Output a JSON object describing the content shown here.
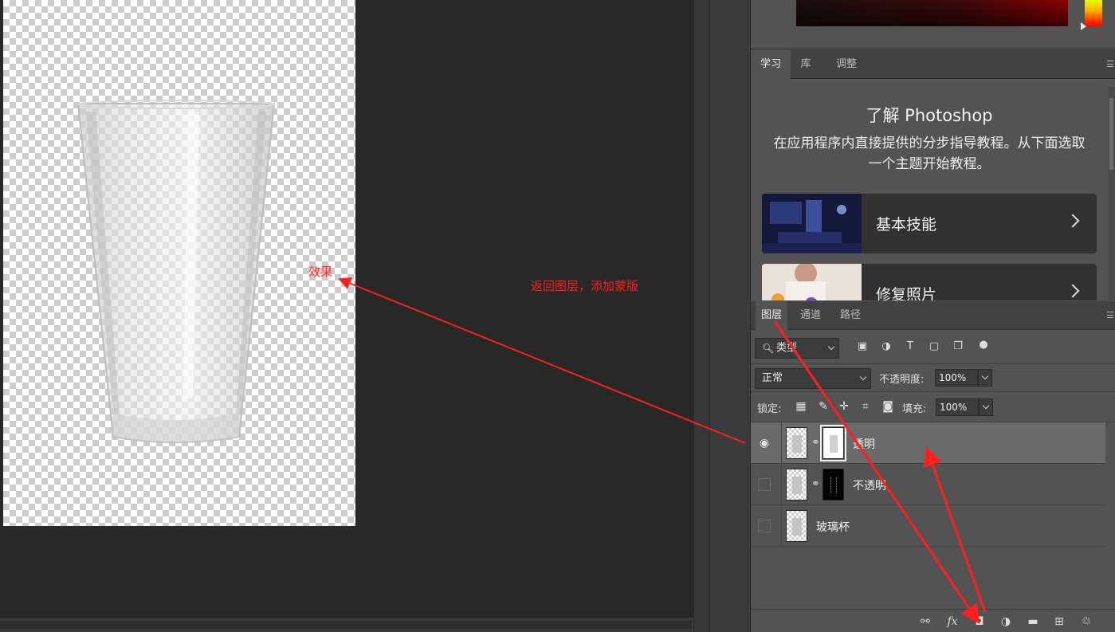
{
  "annotations": {
    "effect": "效果",
    "instruction": "返回图层，添加蒙版"
  },
  "learn_panel": {
    "tabs": [
      "学习",
      "库",
      "调整"
    ],
    "title": "了解 Photoshop",
    "description": "在应用程序内直接提供的分步指导教程。从下面选取一个主题开始教程。",
    "cards": [
      "基本技能",
      "修复照片"
    ]
  },
  "layers_panel": {
    "tabs": [
      "图层",
      "通道",
      "路径"
    ],
    "filter_kind": "类型",
    "blend_mode": "正常",
    "opacity_label": "不透明度:",
    "opacity_value": "100%",
    "lock_label": "锁定:",
    "fill_label": "填充:",
    "fill_value": "100%",
    "layers": [
      {
        "name": "透明",
        "visible": true,
        "selected": true,
        "mask": "white"
      },
      {
        "name": "不透明",
        "visible": false,
        "selected": false,
        "mask": "black"
      },
      {
        "name": "玻璃杯",
        "visible": false,
        "selected": false,
        "mask": "none"
      }
    ],
    "footer_icons": [
      "link-layers-icon",
      "fx-icon",
      "add-mask-icon",
      "adjustment-layer-icon",
      "group-folder-icon",
      "new-layer-icon",
      "delete-icon"
    ],
    "fx_text": "fx"
  },
  "colors": {
    "annotation": "#ff1f1f",
    "panel_bg": "#535353",
    "selected_layer": "#6a6a6a"
  }
}
